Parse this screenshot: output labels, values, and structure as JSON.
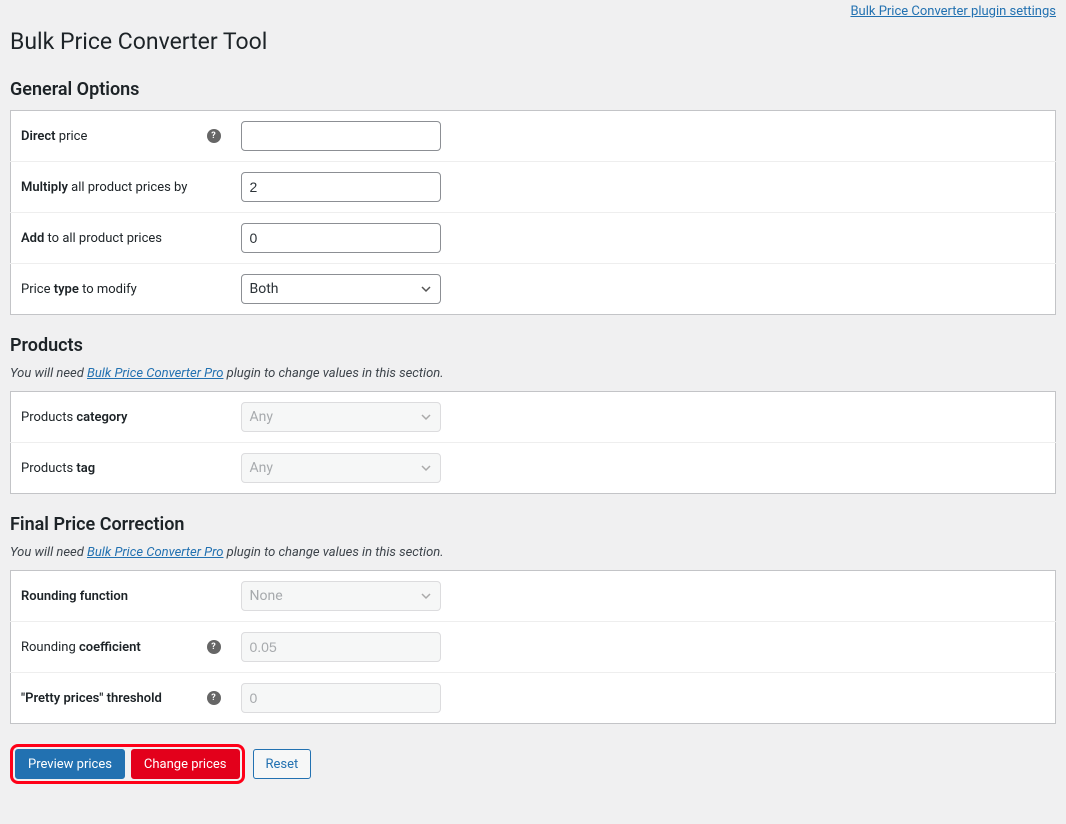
{
  "top_link": "Bulk Price Converter plugin settings",
  "page_title": "Bulk Price Converter Tool",
  "pro_link": "Bulk Price Converter Pro",
  "help_glyph": "?",
  "general": {
    "heading": "General Options",
    "rows": {
      "direct": {
        "label_b": "Direct",
        "label_rest": " price",
        "value": ""
      },
      "multiply": {
        "label_b": "Multiply",
        "label_rest": " all product prices by",
        "value": "2"
      },
      "add": {
        "label_b": "Add",
        "label_rest": " to all product prices",
        "value": "0"
      },
      "type": {
        "label_pre": "Price ",
        "label_b": "type",
        "label_rest": " to modify",
        "value": "Both"
      }
    }
  },
  "products": {
    "heading": "Products",
    "note_pre": "You will need ",
    "note_post": " plugin to change values in this section.",
    "rows": {
      "category": {
        "label_pre": "Products ",
        "label_b": "category",
        "value": "Any"
      },
      "tag": {
        "label_pre": "Products ",
        "label_b": "tag",
        "value": "Any"
      }
    }
  },
  "final": {
    "heading": "Final Price Correction",
    "note_pre": "You will need ",
    "note_post": " plugin to change values in this section.",
    "rows": {
      "rounding_fn": {
        "label_pre": "Rounding ",
        "label_b": "function",
        "value": "None"
      },
      "rounding_coef": {
        "label_pre": "Rounding ",
        "label_b": "coefficient",
        "value": "0.05"
      },
      "pretty": {
        "label_pre": "\"Pretty prices\" ",
        "label_b": "threshold",
        "value": "0"
      }
    }
  },
  "actions": {
    "preview": "Preview prices",
    "change": "Change prices",
    "reset": "Reset"
  }
}
